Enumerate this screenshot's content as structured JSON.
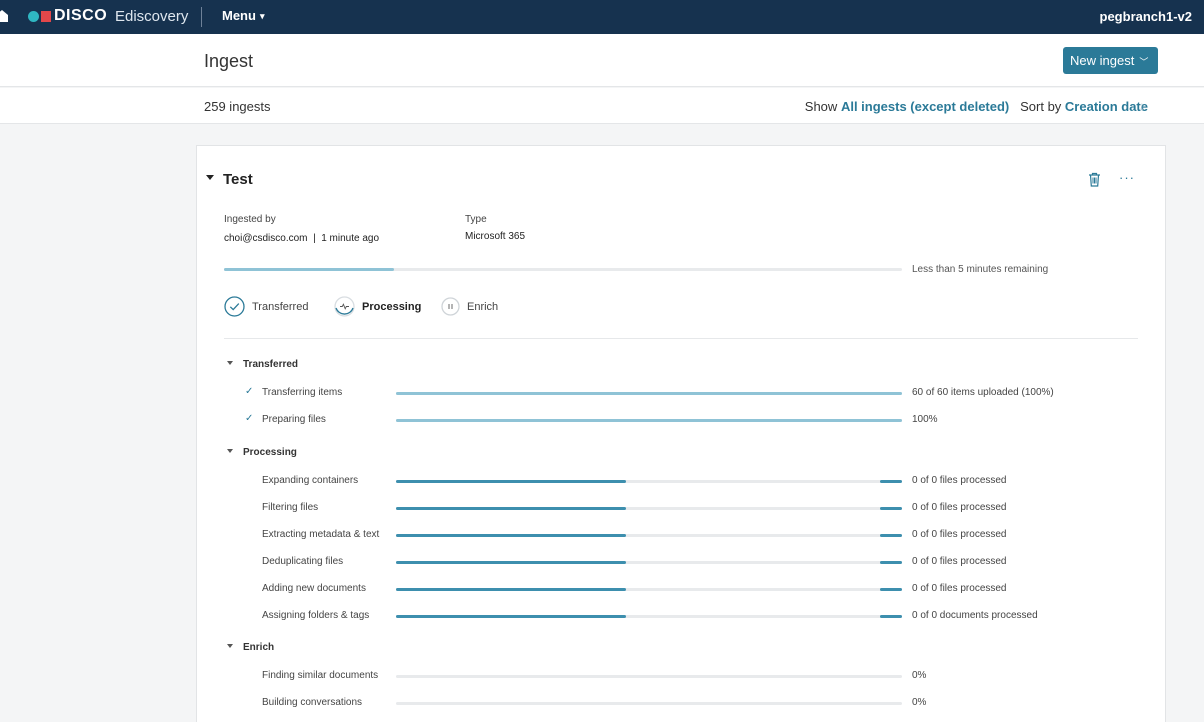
{
  "nav": {
    "brand": "DISCO",
    "product": "Ediscovery",
    "menu_label": "Menu",
    "user": "pegbranch1-v2",
    "colors": {
      "bar": "#16324f",
      "dot": "#2fb6c2",
      "square": "#e2474a"
    }
  },
  "header": {
    "title": "Ingest",
    "new_ingest_label": "New ingest"
  },
  "toolbar": {
    "count": "259 ingests",
    "show_prefix": "Show",
    "show_value": "All ingests (except deleted)",
    "sort_prefix": "Sort by",
    "sort_value": "Creation date"
  },
  "ingest": {
    "title": "Test",
    "ingested_by_label": "Ingested by",
    "ingested_by_value": "choi@csdisco.com  |  1 minute ago",
    "type_label": "Type",
    "type_value": "Microsoft 365",
    "overall_progress": 0.25,
    "remaining": "Less than 5 minutes remaining",
    "stages": [
      {
        "label": "Transferred",
        "state": "done"
      },
      {
        "label": "Processing",
        "state": "active"
      },
      {
        "label": "Enrich",
        "state": "paused"
      }
    ],
    "sections": [
      {
        "title": "Transferred",
        "tasks": [
          {
            "label": "Transferring items",
            "status": "60 of 60 items uploaded (100%)",
            "progress": 1.0,
            "done": true
          },
          {
            "label": "Preparing files",
            "status": "100%",
            "progress": 1.0,
            "done": true
          }
        ]
      },
      {
        "title": "Processing",
        "tasks": [
          {
            "label": "Expanding containers",
            "status": "0 of 0 files processed",
            "indeterminate": true
          },
          {
            "label": "Filtering files",
            "status": "0 of 0 files processed",
            "indeterminate": true
          },
          {
            "label": "Extracting metadata & text",
            "status": "0 of 0 files processed",
            "indeterminate": true
          },
          {
            "label": "Deduplicating files",
            "status": "0 of 0 files processed",
            "indeterminate": true
          },
          {
            "label": "Adding new documents",
            "status": "0 of 0 files processed",
            "indeterminate": true
          },
          {
            "label": "Assigning folders & tags",
            "status": "0 of 0 documents processed",
            "indeterminate": true
          }
        ]
      },
      {
        "title": "Enrich",
        "tasks": [
          {
            "label": "Finding similar documents",
            "status": "0%",
            "progress": 0
          },
          {
            "label": "Building conversations",
            "status": "0%",
            "progress": 0
          }
        ]
      }
    ]
  }
}
